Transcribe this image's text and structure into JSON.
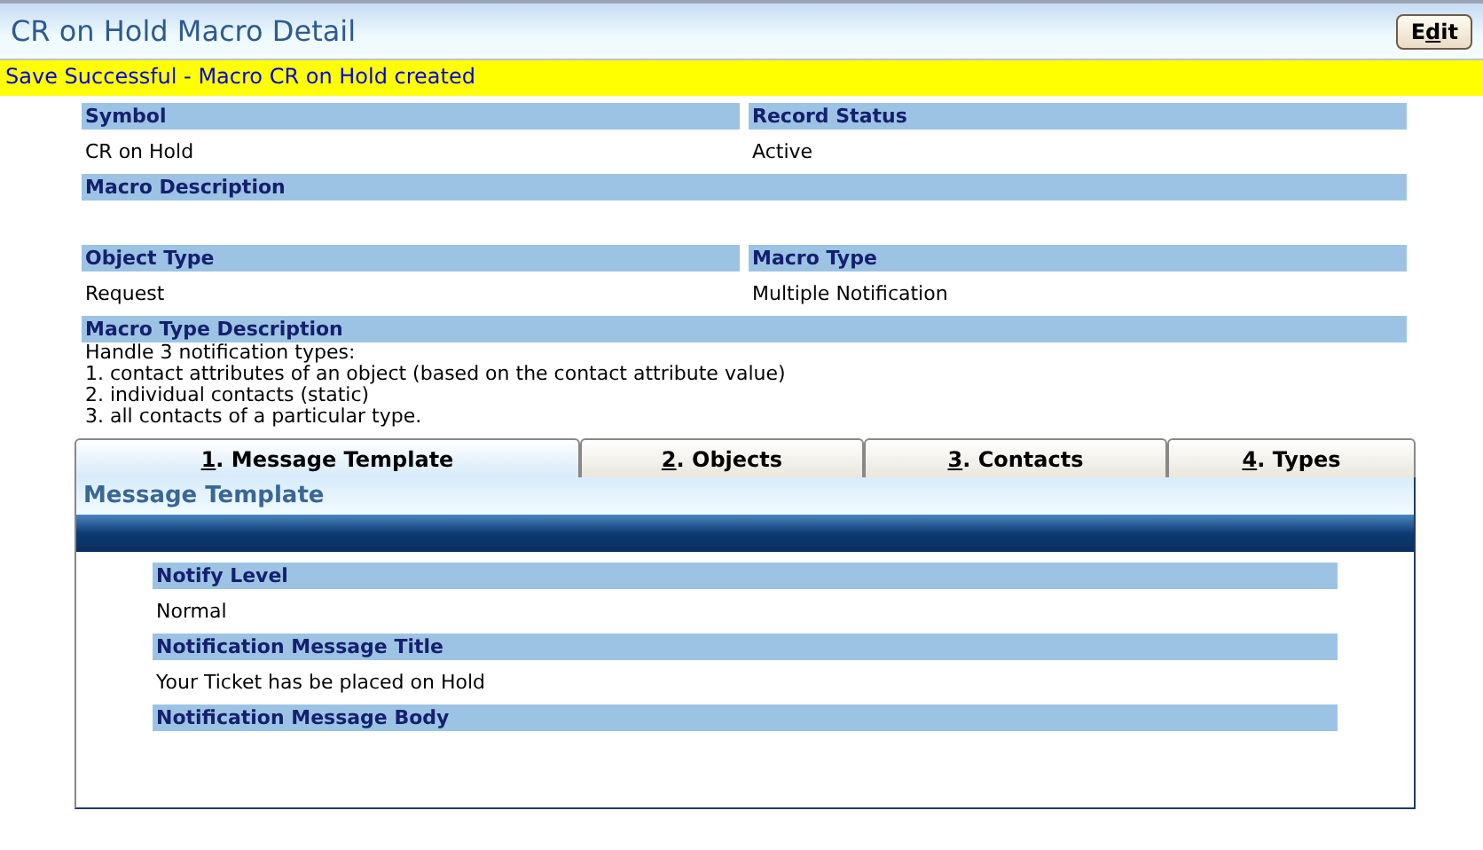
{
  "header": {
    "title": "CR on Hold Macro Detail",
    "edit_button": {
      "before": "E",
      "access_key": "d",
      "after": "it"
    }
  },
  "message": "Save Successful - Macro CR on Hold created",
  "fields": [
    [
      {
        "label": "Symbol",
        "value": [
          "CR on Hold"
        ]
      },
      {
        "label": "Record Status",
        "value": [
          "Active"
        ]
      }
    ],
    [
      {
        "label": "Macro Description"
      }
    ],
    [
      {
        "label": "Object Type",
        "value": [
          "Request"
        ]
      },
      {
        "label": "Macro Type",
        "value": [
          "Multiple Notification"
        ]
      }
    ],
    [
      {
        "label": "Macro Type Description",
        "value": [
          "Handle 3 notification types:",
          "1. contact attributes of an object (based on the contact attribute value)",
          "2. individual contacts (static)",
          "3. all contacts of a particular type."
        ]
      }
    ]
  ],
  "tabs": [
    {
      "access_key": "1",
      "after": ". Message Template",
      "selected": true
    },
    {
      "access_key": "2",
      "after": ". Objects",
      "selected": false
    },
    {
      "access_key": "3",
      "after": ". Contacts",
      "selected": false
    },
    {
      "access_key": "4",
      "after": ". Types",
      "selected": false
    }
  ],
  "panel": {
    "title": "Message Template",
    "fields": [
      {
        "label": "Notify Level",
        "value": "Normal"
      },
      {
        "label": "Notification Message Title",
        "value": "Your Ticket has be placed on Hold"
      },
      {
        "label": "Notification Message Body"
      }
    ]
  }
}
